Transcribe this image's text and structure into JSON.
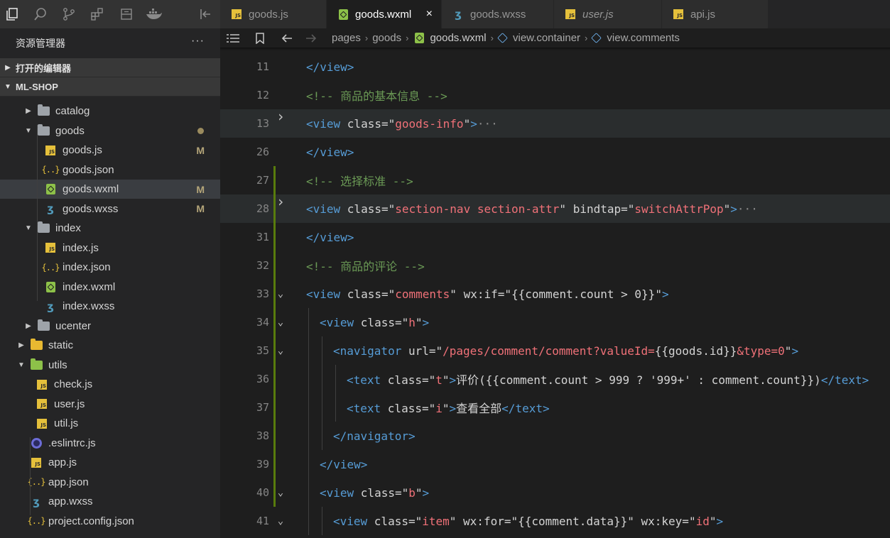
{
  "activity_icons": [
    "explorer-icon",
    "search-icon",
    "source-control-icon",
    "extensions-icon",
    "layout-icon",
    "docker-icon",
    "collapse-panel-icon"
  ],
  "sidebar": {
    "title": "资源管理器",
    "more": "···",
    "open_editors": "打开的编辑器",
    "project": "ML-SHOP",
    "tree": [
      {
        "label": "catalog",
        "type": "folder",
        "depth": 2,
        "state": "collapsed"
      },
      {
        "label": "goods",
        "type": "folder",
        "depth": 2,
        "state": "expanded",
        "modified_dot": true
      },
      {
        "label": "goods.js",
        "type": "js",
        "depth": 3,
        "badge": "M"
      },
      {
        "label": "goods.json",
        "type": "json",
        "depth": 3
      },
      {
        "label": "goods.wxml",
        "type": "wxml",
        "depth": 3,
        "badge": "M",
        "active": true
      },
      {
        "label": "goods.wxss",
        "type": "wxss",
        "depth": 3,
        "badge": "M"
      },
      {
        "label": "index",
        "type": "folder",
        "depth": 2,
        "state": "expanded"
      },
      {
        "label": "index.js",
        "type": "js",
        "depth": 3
      },
      {
        "label": "index.json",
        "type": "json",
        "depth": 3
      },
      {
        "label": "index.wxml",
        "type": "wxml",
        "depth": 3
      },
      {
        "label": "index.wxss",
        "type": "wxss",
        "depth": 3
      },
      {
        "label": "ucenter",
        "type": "folder",
        "depth": 2,
        "state": "collapsed"
      },
      {
        "label": "static",
        "type": "folder-yellow",
        "depth": 1,
        "state": "collapsed"
      },
      {
        "label": "utils",
        "type": "folder-green",
        "depth": 1,
        "state": "expanded"
      },
      {
        "label": "check.js",
        "type": "js",
        "depth": 2
      },
      {
        "label": "user.js",
        "type": "js",
        "depth": 2
      },
      {
        "label": "util.js",
        "type": "js",
        "depth": 2
      },
      {
        "label": ".eslintrc.js",
        "type": "eslint",
        "depth": 1
      },
      {
        "label": "app.js",
        "type": "js",
        "depth": 1
      },
      {
        "label": "app.json",
        "type": "json",
        "depth": 1
      },
      {
        "label": "app.wxss",
        "type": "wxss",
        "depth": 1
      },
      {
        "label": "project.config.json",
        "type": "json",
        "depth": 1
      }
    ]
  },
  "tabs": [
    {
      "label": "goods.js",
      "type": "js"
    },
    {
      "label": "goods.wxml",
      "type": "wxml",
      "active": true,
      "close": "×"
    },
    {
      "label": "goods.wxss",
      "type": "wxss"
    },
    {
      "label": "user.js",
      "type": "js",
      "italic": true
    },
    {
      "label": "api.js",
      "type": "js"
    }
  ],
  "breadcrumb": [
    "pages",
    "goods",
    "goods.wxml",
    "view.container",
    "view.comments"
  ],
  "editor": {
    "lines": [
      {
        "n": "11",
        "tokens": [
          [
            "tag",
            "</view>"
          ]
        ]
      },
      {
        "n": "12",
        "tokens": [
          [
            "com",
            "<!-- 商品的基本信息 -->"
          ]
        ]
      },
      {
        "n": "13",
        "fold": "›",
        "hl": true,
        "tokens": [
          [
            "tag",
            "<view "
          ],
          [
            "attr",
            "class="
          ],
          [
            "str",
            "\""
          ],
          [
            "val",
            "goods-info"
          ],
          [
            "str",
            "\""
          ],
          [
            "tag",
            ">"
          ],
          [
            "dots",
            "···"
          ]
        ]
      },
      {
        "n": "26",
        "tokens": [
          [
            "tag",
            "</view>"
          ]
        ]
      },
      {
        "n": "27",
        "tokens": [
          [
            "com",
            "<!-- 选择标准 -->"
          ]
        ]
      },
      {
        "n": "28",
        "fold": "›",
        "hl": true,
        "tokens": [
          [
            "tag",
            "<view "
          ],
          [
            "attr",
            "class="
          ],
          [
            "str",
            "\""
          ],
          [
            "val",
            "section-nav section-attr"
          ],
          [
            "str",
            "\""
          ],
          [
            "attr",
            " bindtap="
          ],
          [
            "str",
            "\""
          ],
          [
            "val",
            "switchAttrPop"
          ],
          [
            "str",
            "\""
          ],
          [
            "tag",
            ">"
          ],
          [
            "dots",
            "···"
          ]
        ]
      },
      {
        "n": "31",
        "tokens": [
          [
            "tag",
            "</view>"
          ]
        ]
      },
      {
        "n": "32",
        "tokens": [
          [
            "com",
            "<!-- 商品的评论 -->"
          ]
        ]
      },
      {
        "n": "33",
        "fold": "⌄",
        "tokens": [
          [
            "tag",
            "<view "
          ],
          [
            "attr",
            "class="
          ],
          [
            "str",
            "\""
          ],
          [
            "val",
            "comments"
          ],
          [
            "str",
            "\""
          ],
          [
            "attr",
            " wx:if="
          ],
          [
            "str",
            "\""
          ],
          [
            "attr",
            "{{comment.count "
          ],
          [
            "str",
            "> 0"
          ],
          [
            "attr",
            "}}"
          ],
          [
            "str",
            "\""
          ],
          [
            "tag",
            ">"
          ]
        ]
      },
      {
        "n": "34",
        "fold": "⌄",
        "indent": 1,
        "tokens": [
          [
            "tag",
            "<view "
          ],
          [
            "attr",
            "class="
          ],
          [
            "str",
            "\""
          ],
          [
            "val",
            "h"
          ],
          [
            "str",
            "\""
          ],
          [
            "tag",
            ">"
          ]
        ]
      },
      {
        "n": "35",
        "fold": "⌄",
        "indent": 2,
        "tokens": [
          [
            "tag",
            "<navigator "
          ],
          [
            "attr",
            "url="
          ],
          [
            "str",
            "\""
          ],
          [
            "val",
            "/pages/comment/comment?valueId="
          ],
          [
            "attr",
            "{{goods.id}}"
          ],
          [
            "val",
            "&type=0"
          ],
          [
            "str",
            "\""
          ],
          [
            "tag",
            ">"
          ]
        ]
      },
      {
        "n": "36",
        "indent": 3,
        "tokens": [
          [
            "tag",
            "<text "
          ],
          [
            "attr",
            "class="
          ],
          [
            "str",
            "\""
          ],
          [
            "val",
            "t"
          ],
          [
            "str",
            "\""
          ],
          [
            "tag",
            ">"
          ],
          [
            "attr",
            "评价({{comment.count "
          ],
          [
            "str",
            "> 999 ? '999+'"
          ],
          [
            "attr",
            " : comment.count}})"
          ],
          [
            "tag",
            "</text>"
          ]
        ]
      },
      {
        "n": "37",
        "indent": 3,
        "tokens": [
          [
            "tag",
            "<text "
          ],
          [
            "attr",
            "class="
          ],
          [
            "str",
            "\""
          ],
          [
            "val",
            "i"
          ],
          [
            "str",
            "\""
          ],
          [
            "tag",
            ">"
          ],
          [
            "attr",
            "查看全部"
          ],
          [
            "tag",
            "</text>"
          ]
        ]
      },
      {
        "n": "38",
        "indent": 2,
        "tokens": [
          [
            "tag",
            "</navigator>"
          ]
        ]
      },
      {
        "n": "39",
        "indent": 1,
        "tokens": [
          [
            "tag",
            "</view>"
          ]
        ]
      },
      {
        "n": "40",
        "fold": "⌄",
        "indent": 1,
        "tokens": [
          [
            "tag",
            "<view "
          ],
          [
            "attr",
            "class="
          ],
          [
            "str",
            "\""
          ],
          [
            "val",
            "b"
          ],
          [
            "str",
            "\""
          ],
          [
            "tag",
            ">"
          ]
        ]
      },
      {
        "n": "41",
        "fold": "⌄",
        "indent": 2,
        "tokens": [
          [
            "tag",
            "<view "
          ],
          [
            "attr",
            "class="
          ],
          [
            "str",
            "\""
          ],
          [
            "val",
            "item"
          ],
          [
            "str",
            "\""
          ],
          [
            "attr",
            " wx:for="
          ],
          [
            "str",
            "\""
          ],
          [
            "attr",
            "{{comment.data}}"
          ],
          [
            "str",
            "\""
          ],
          [
            "attr",
            " wx:key="
          ],
          [
            "str",
            "\""
          ],
          [
            "val",
            "id"
          ],
          [
            "str",
            "\""
          ],
          [
            "tag",
            ">"
          ]
        ]
      }
    ]
  }
}
